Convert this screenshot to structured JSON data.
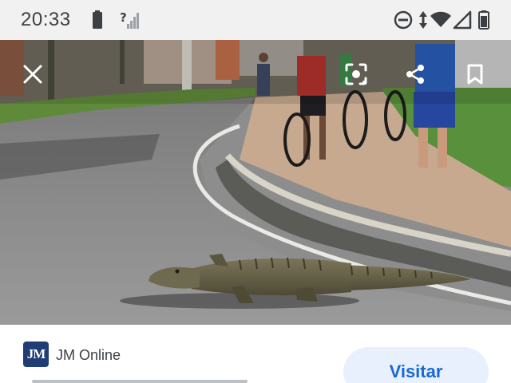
{
  "status_bar": {
    "time": "20:33",
    "icons": [
      "battery-saver-icon",
      "mobile-signal-unknown-icon",
      "do-not-disturb-icon",
      "data-transfer-icon",
      "wifi-icon",
      "cell-signal-icon",
      "battery-icon"
    ]
  },
  "viewer": {
    "close_icon": "close-icon",
    "actions": [
      "lens-search-icon",
      "share-icon",
      "bookmark-icon"
    ],
    "image_subject": "alligator crossing road"
  },
  "source": {
    "logo_text": "JM",
    "name": "JM Online",
    "visit_label": "Visitar"
  },
  "colors": {
    "accent": "#1967d2",
    "button_bg": "#e8f0fe",
    "status_bg": "#f1f1f1",
    "logo_bg": "#1f3c74"
  }
}
